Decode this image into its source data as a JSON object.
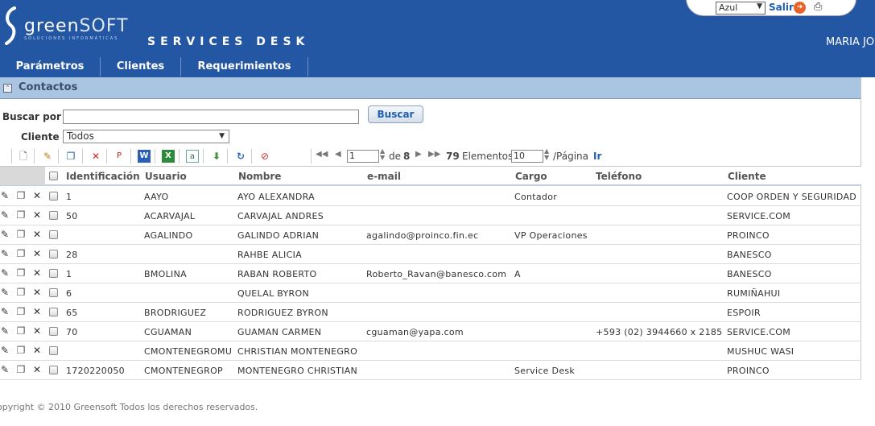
{
  "header": {
    "logo_main": "green",
    "logo_soft": "SOFT",
    "logo_tagline": "SOLUCIONES INFORMÁTICAS",
    "app_title": "SERVICES DESK",
    "user_name": "MARIA JO"
  },
  "top_controls": {
    "theme_value": "Azul",
    "logout_label": "Salir"
  },
  "nav": {
    "items": [
      {
        "label": "Parámetros"
      },
      {
        "label": "Clientes"
      },
      {
        "label": "Requerimientos"
      }
    ]
  },
  "section": {
    "title": "Contactos"
  },
  "search": {
    "search_label": "Buscar por",
    "search_value": "",
    "search_button": "Buscar",
    "client_label": "Cliente",
    "client_value": "Todos"
  },
  "toolbar": {
    "icons": [
      "new-document-icon",
      "edit-icon",
      "copy-icon",
      "delete-icon",
      "pdf-icon",
      "word-icon",
      "excel-icon",
      "text-export-icon",
      "download-icon",
      "refresh-icon",
      "clear-filter-icon"
    ]
  },
  "pager": {
    "current_page": "1",
    "of_label": "de",
    "total_pages": "8",
    "total_items": "79",
    "items_label": "Elementos",
    "page_size": "10",
    "per_page_label": "/Página",
    "go_label": "Ir"
  },
  "table": {
    "columns": [
      "Identificación",
      "Usuario",
      "Nombre",
      "e-mail",
      "Cargo",
      "Teléfono",
      "Cliente"
    ],
    "rows": [
      {
        "id": "1",
        "usuario": "AAYO",
        "nombre": "AYO ALEXANDRA",
        "email": "",
        "cargo": "Contador",
        "telefono": "",
        "cliente": "COOP ORDEN Y SEGURIDAD"
      },
      {
        "id": "50",
        "usuario": "ACARVAJAL",
        "nombre": "CARVAJAL ANDRES",
        "email": "",
        "cargo": "",
        "telefono": "",
        "cliente": "SERVICE.COM"
      },
      {
        "id": "",
        "usuario": "AGALINDO",
        "nombre": "GALINDO ADRIAN",
        "email": "agalindo@proinco.fin.ec",
        "cargo": "VP Operaciones",
        "telefono": "",
        "cliente": "PROINCO"
      },
      {
        "id": "28",
        "usuario": "",
        "nombre": "RAHBE ALICIA",
        "email": "",
        "cargo": "",
        "telefono": "",
        "cliente": "BANESCO"
      },
      {
        "id": "1",
        "usuario": "BMOLINA",
        "nombre": "RABAN ROBERTO",
        "email": "Roberto_Ravan@banesco.com",
        "cargo": "A",
        "telefono": "",
        "cliente": "BANESCO"
      },
      {
        "id": "6",
        "usuario": "",
        "nombre": "QUELAL BYRON",
        "email": "",
        "cargo": "",
        "telefono": "",
        "cliente": "RUMIÑAHUI"
      },
      {
        "id": "65",
        "usuario": "BRODRIGUEZ",
        "nombre": "RODRIGUEZ BYRON",
        "email": "",
        "cargo": "",
        "telefono": "",
        "cliente": "ESPOIR"
      },
      {
        "id": "70",
        "usuario": "CGUAMAN",
        "nombre": "GUAMAN CARMEN",
        "email": "cguaman@yapa.com",
        "cargo": "",
        "telefono": "+593 (02) 3944660 x 2185",
        "cliente": "SERVICE.COM"
      },
      {
        "id": "",
        "usuario": "CMONTENEGROMU",
        "nombre": "CHRISTIAN MONTENEGRO",
        "email": "",
        "cargo": "",
        "telefono": "",
        "cliente": "MUSHUC WASI"
      },
      {
        "id": "1720220050",
        "usuario": "CMONTENEGROP",
        "nombre": "MONTENEGRO CHRISTIAN",
        "email": "",
        "cargo": "Service Desk",
        "telefono": "",
        "cliente": "PROINCO"
      }
    ]
  },
  "footer": {
    "text": "opyright © 2010 Greensoft Todos los derechos reservados."
  },
  "colors": {
    "header_bg": "#2356a3",
    "section_bar": "#a9c5e2",
    "link": "#1f5fb0"
  }
}
